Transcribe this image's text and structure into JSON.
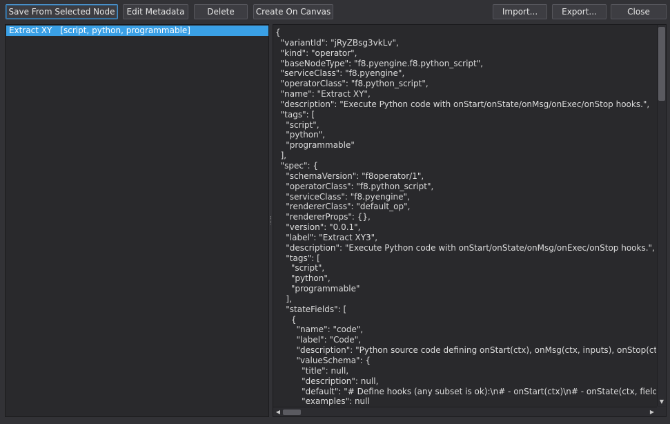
{
  "toolbar": {
    "save_from_selected_node": "Save From Selected Node",
    "edit_metadata": "Edit Metadata",
    "delete": "Delete",
    "create_on_canvas": "Create On Canvas",
    "import": "Import...",
    "export": "Export...",
    "close": "Close"
  },
  "variants": [
    {
      "name": "Extract XY",
      "tags": "[script, python, programmable]"
    }
  ],
  "json_lines": [
    "{",
    "  \"variantId\": \"jRyZBsg3vkLv\",",
    "  \"kind\": \"operator\",",
    "  \"baseNodeType\": \"f8.pyengine.f8.python_script\",",
    "  \"serviceClass\": \"f8.pyengine\",",
    "  \"operatorClass\": \"f8.python_script\",",
    "  \"name\": \"Extract XY\",",
    "  \"description\": \"Execute Python code with onStart/onState/onMsg/onExec/onStop hooks.\",",
    "  \"tags\": [",
    "    \"script\",",
    "    \"python\",",
    "    \"programmable\"",
    "  ],",
    "  \"spec\": {",
    "    \"schemaVersion\": \"f8operator/1\",",
    "    \"operatorClass\": \"f8.python_script\",",
    "    \"serviceClass\": \"f8.pyengine\",",
    "    \"rendererClass\": \"default_op\",",
    "    \"rendererProps\": {},",
    "    \"version\": \"0.0.1\",",
    "    \"label\": \"Extract XY3\",",
    "    \"description\": \"Execute Python code with onStart/onState/onMsg/onExec/onStop hooks.\",",
    "    \"tags\": [",
    "      \"script\",",
    "      \"python\",",
    "      \"programmable\"",
    "    ],",
    "    \"stateFields\": [",
    "      {",
    "        \"name\": \"code\",",
    "        \"label\": \"Code\",",
    "        \"description\": \"Python source code defining onStart(ctx), onMsg(ctx, inputs), onStop(ctx).\",",
    "        \"valueSchema\": {",
    "          \"title\": null,",
    "          \"description\": null,",
    "          \"default\": \"# Define hooks (any subset is ok):\\n# - onStart(ctx)\\n# - onState(ctx, field, value",
    "          \"examples\": null"
  ]
}
